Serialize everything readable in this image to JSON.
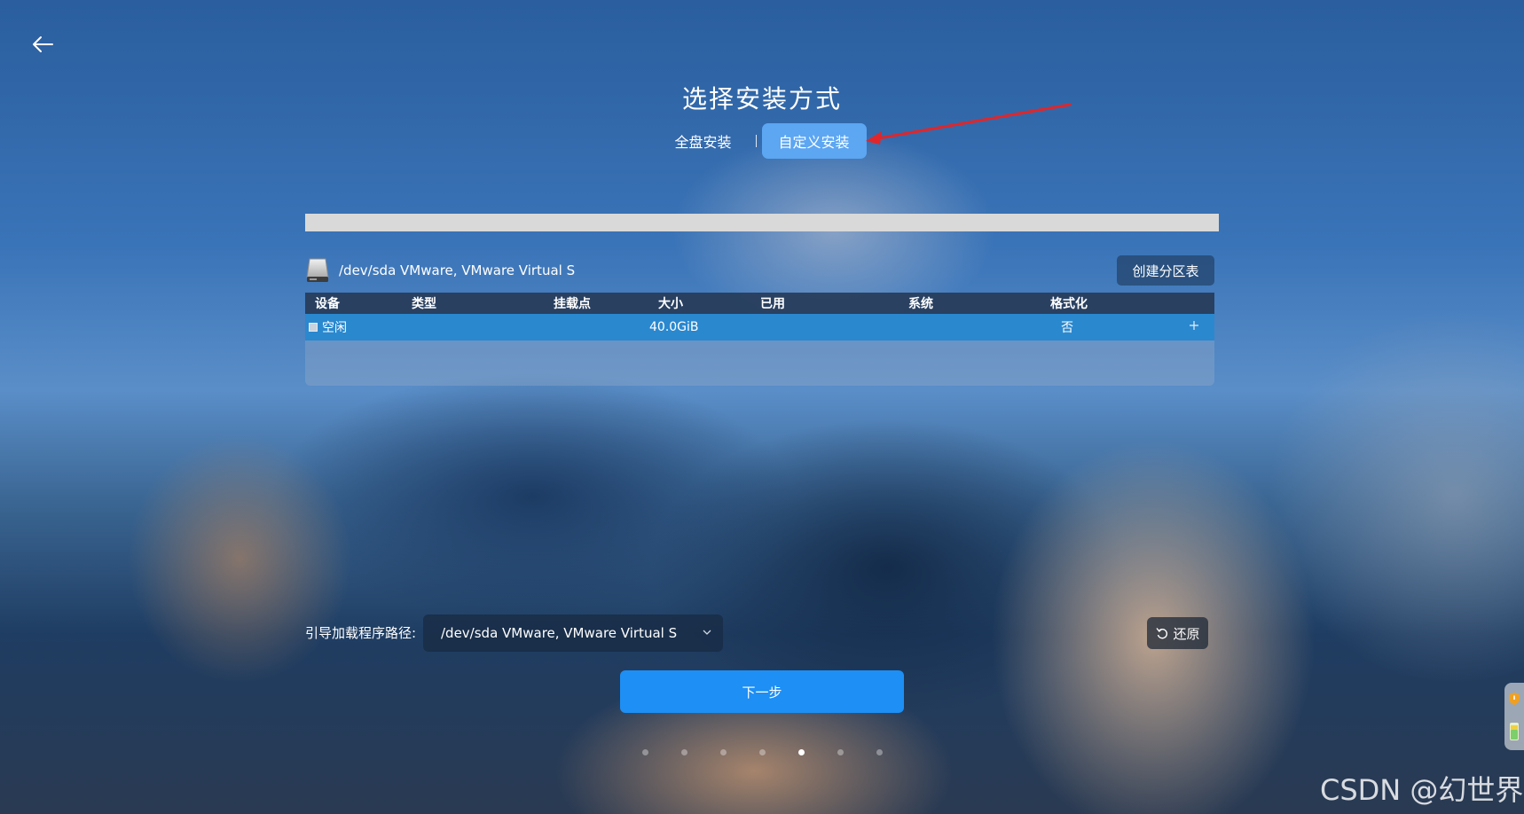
{
  "page": {
    "title": "选择安装方式"
  },
  "install_modes": [
    {
      "label": "全盘安装",
      "selected": false
    },
    {
      "label": "自定义安装",
      "selected": true
    }
  ],
  "disk": {
    "label": "/dev/sda VMware, VMware Virtual S",
    "icon": "hard-drive-icon",
    "create_table_button": "创建分区表"
  },
  "partition_table": {
    "columns": [
      "设备",
      "类型",
      "挂载点",
      "大小",
      "已用",
      "系统",
      "格式化"
    ],
    "rows": [
      {
        "device": "空闲",
        "type": "",
        "mount": "",
        "size": "40.0GiB",
        "used": "",
        "system": "",
        "format": "否",
        "action_icon": "plus-icon"
      }
    ]
  },
  "bootloader": {
    "label": "引导加载程序路径:",
    "selected": "/dev/sda VMware, VMware Virtual S"
  },
  "buttons": {
    "restore": "还原",
    "next": "下一步"
  },
  "progress_steps": {
    "total": 7,
    "current": 5
  },
  "colors": {
    "accent": "#1d8ff5",
    "selected_tab": "#5ca6f2",
    "selected_row": "#2a88cf",
    "annotation_arrow": "#e0262a"
  },
  "watermark": "CSDN @幻世界"
}
